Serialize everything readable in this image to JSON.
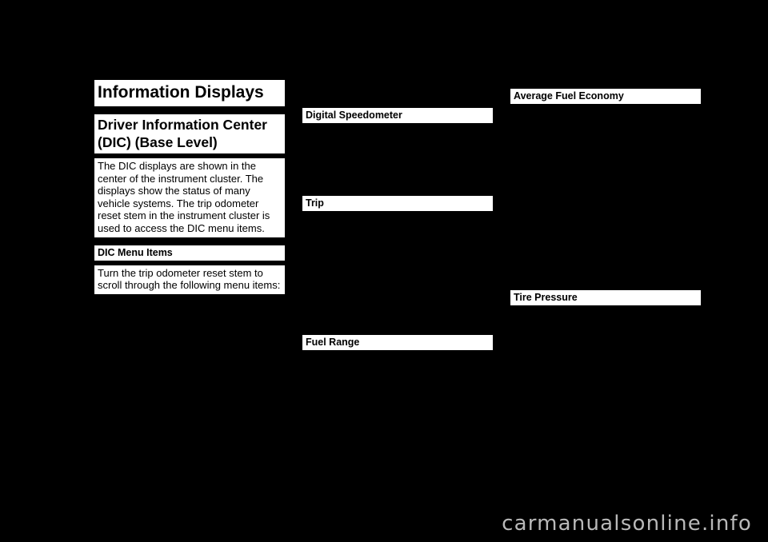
{
  "page": {
    "background_color": "#000000",
    "text_color": "#ffffff",
    "block_color": "#ffffff"
  },
  "left_column": {
    "title": "Information Displays",
    "section_heading": "Driver Information Center (DIC) (Base Level)",
    "section_body": "The DIC displays are shown in the center of the instrument cluster. The displays show the status of many vehicle systems. The trip odometer reset stem in the instrument cluster is used to access the DIC menu items.",
    "subheading": "DIC Menu Items",
    "subheading_body": "Turn the trip odometer reset stem to scroll through the following menu items:"
  },
  "middle_column": {
    "heading_1": "Digital Speedometer",
    "heading_2": "Trip",
    "heading_3": "Fuel Range"
  },
  "right_column": {
    "heading_1": "Average Fuel Economy",
    "heading_2": "Tire Pressure"
  },
  "watermark": {
    "text": "carmanualsonline.info"
  }
}
